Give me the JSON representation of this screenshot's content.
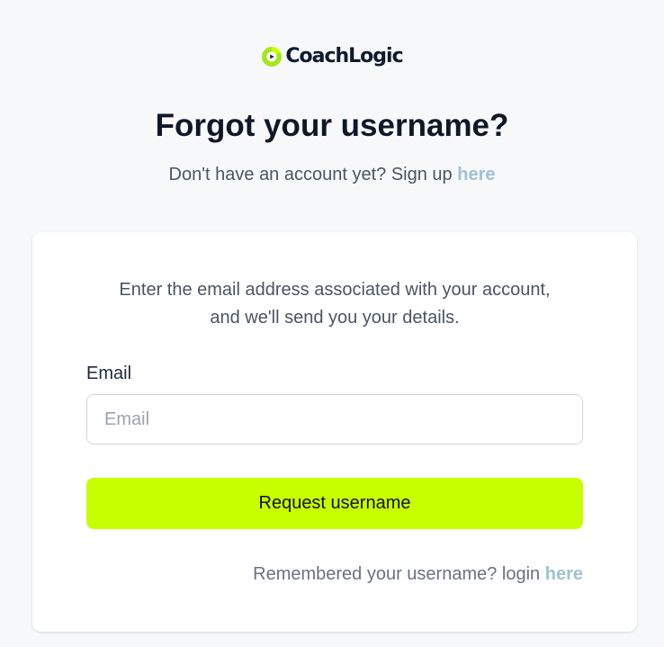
{
  "brand": {
    "name": "CoachLogic",
    "accent_color": "#c8ff00",
    "icon": "coachlogic-logo-icon"
  },
  "page": {
    "title": "Forgot your username?",
    "signup_prompt": "Don't have an account yet? Sign up",
    "signup_link": "here"
  },
  "form": {
    "instructions_line1": "Enter the email address associated with your account,",
    "instructions_line2": "and we'll send you your details.",
    "email_label": "Email",
    "email_placeholder": "Email",
    "email_value": "",
    "submit_label": "Request username",
    "login_prompt": "Remembered your username? login",
    "login_link": "here"
  },
  "colors": {
    "background": "#f7f8fa",
    "link": "#9ec2d6",
    "button": "#c8ff00"
  }
}
